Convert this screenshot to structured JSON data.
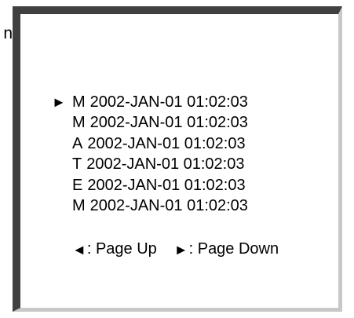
{
  "side_label": "n",
  "cursor_glyph": "►",
  "log_entries": [
    {
      "type": "M",
      "timestamp": "2002-JAN-01 01:02:03",
      "selected": true
    },
    {
      "type": "M",
      "timestamp": "2002-JAN-01 01:02:03",
      "selected": false
    },
    {
      "type": "A",
      "timestamp": "2002-JAN-01 01:02:03",
      "selected": false
    },
    {
      "type": "T",
      "timestamp": "2002-JAN-01 01:02:03",
      "selected": false
    },
    {
      "type": "E",
      "timestamp": "2002-JAN-01 01:02:03",
      "selected": false
    },
    {
      "type": "M",
      "timestamp": "2002-JAN-01 01:02:03",
      "selected": false
    }
  ],
  "nav": {
    "page_up_glyph": "◄",
    "page_up_label": ": Page Up",
    "page_down_glyph": "►",
    "page_down_label": ": Page Down"
  }
}
